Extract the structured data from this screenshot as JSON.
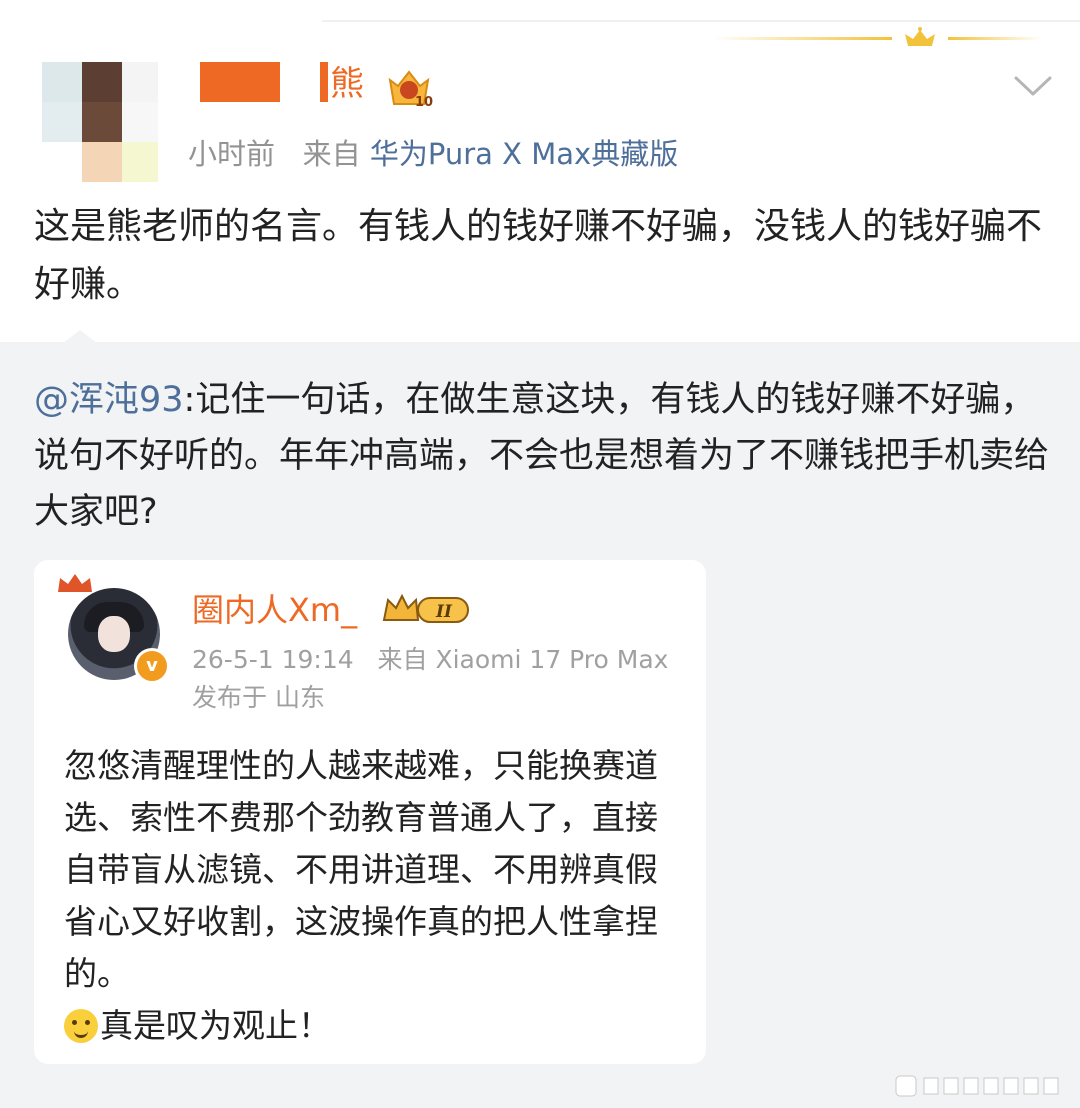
{
  "post": {
    "author_suffix": "熊",
    "time": "小时前",
    "source_prefix": "来自",
    "source_device": "华为Pura X Max典藏版",
    "text": "这是熊老师的名言。有钱人的钱好赚不好骗，没钱人的钱好骗不好赚。"
  },
  "repost": {
    "mention": "@浑沌93",
    "text": ":记住一句话，在做生意这块，有钱人的钱好赚不好骗，说句不好听的。年年冲高端，不会也是想着为了不赚钱把手机卖给大家吧?"
  },
  "embedded": {
    "name": "圈内人Xm_",
    "vip_level": "II",
    "verified_mark": "v",
    "datetime": "26-5-1 19:14",
    "source_prefix": "来自",
    "source_device": "Xiaomi 17 Pro Max",
    "location": "发布于 山东",
    "body_lines": [
      "忽悠清醒理性的人越来越难，只能换赛道",
      "选、索性不费那个劲教育普通人了，直接",
      "自带盲从滤镜、不用讲道理、不用辨真假",
      "省心又好收割，这波操作真的把人性拿捏",
      "的。"
    ],
    "last_line": "真是叹为观止！"
  },
  "icons": {
    "chevron": "chevron-down-icon",
    "crown": "crown-icon",
    "vip": "vip-badge-icon",
    "emoji": "smile-emoji-icon"
  },
  "colors": {
    "accent_orange": "#ee6a24",
    "link_blue": "#4d6f9a",
    "meta_gray": "#939393",
    "repost_bg": "#f2f3f5"
  }
}
